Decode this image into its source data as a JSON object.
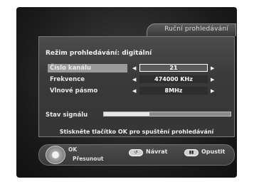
{
  "title": "Ruční prohledávání",
  "mode_label": "Režim prohledávání: digitální",
  "rows": [
    {
      "label": "Číslo kanálu",
      "value": "21"
    },
    {
      "label": "Frekvence",
      "value": "474000 KHz"
    },
    {
      "label": "Vlnové pásmo",
      "value": "8MHz"
    }
  ],
  "signal": {
    "label": "Stav signálu",
    "level_percent": 36
  },
  "hint": "Stiskněte tlačítko OK pro spuštění prohledávání",
  "footer": {
    "ok_label": "OK",
    "move_label": "Přesunout",
    "back_label": "Návrat",
    "exit_label": "Opustit",
    "back_icon": "back-arrow-icon",
    "exit_icon": "exit-key-icon"
  },
  "colors": {
    "highlight": "#9a9a9a",
    "panel": "#3a3a3a"
  }
}
